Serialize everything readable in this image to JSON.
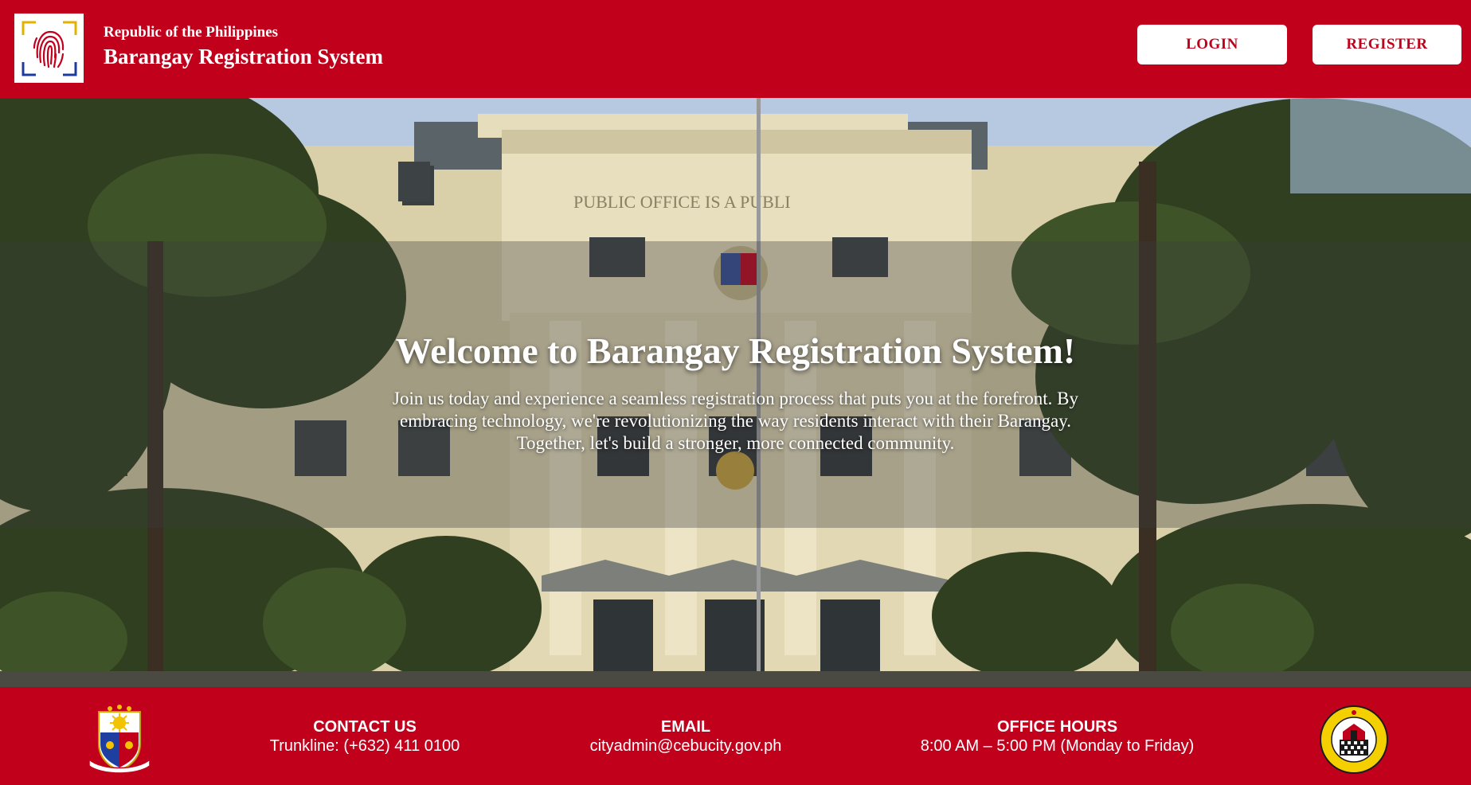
{
  "header": {
    "republic_label": "Republic of the Philippines",
    "system_title": "Barangay Registration System",
    "logo_icon": "fingerprint-icon",
    "login_label": "LOGIN",
    "register_label": "REGISTER"
  },
  "hero": {
    "building_inscription": "PUBLIC OFFICE IS A PUBLI",
    "heading": "Welcome to Barangay Registration System!",
    "body": "Join us today and experience a seamless registration process that puts you at the forefront. By embracing technology, we're revolutionizing the way residents interact with their Barangay. Together, let's build a stronger, more connected community."
  },
  "footer": {
    "contact_label": "CONTACT US",
    "contact_value": "Trunkline: (+632) 411 0100",
    "email_label": "EMAIL",
    "email_value": "cityadmin@cebucity.gov.ph",
    "hours_label": "OFFICE HOURS",
    "hours_value": "8:00 AM – 5:00 PM (Monday to Friday)",
    "left_emblem": "philippine-coat-of-arms-icon",
    "right_seal": "cebu-city-official-seal-icon"
  },
  "colors": {
    "brand_red": "#c1011c",
    "button_bg": "#ffffff",
    "text_light": "#ffffff"
  }
}
